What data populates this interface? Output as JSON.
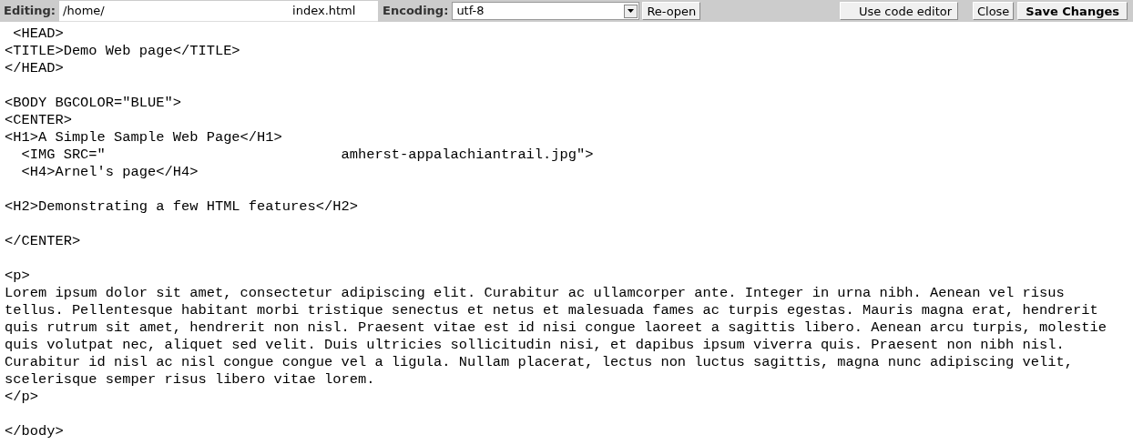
{
  "toolbar": {
    "editing_label": "Editing:",
    "path": "/home/",
    "filename": "index.html",
    "encoding_label": "Encoding:",
    "encoding": "utf-8",
    "reopen": "Re-open",
    "code_editor": "Use code editor",
    "close": "Close",
    "save": "Save Changes"
  },
  "editor": {
    "blocks": [
      {
        "lines": [
          " <HEAD>",
          "<TITLE>Demo Web page</TITLE>",
          "</HEAD>"
        ]
      },
      {
        "lines": [
          "<BODY BGCOLOR=\"BLUE\">",
          "<CENTER>",
          "<H1>A Simple Sample Web Page</H1>",
          "  <IMG SRC=\"                            amherst-appalachiantrail.jpg\">",
          "  <H4>Arnel's page</H4>"
        ]
      },
      {
        "lines": [
          "<H2>Demonstrating a few HTML features</H2>"
        ]
      },
      {
        "lines": [
          "</CENTER>"
        ]
      },
      {
        "lines": [
          "<p>",
          "Lorem ipsum dolor sit amet, consectetur adipiscing elit. Curabitur ac ullamcorper ante. Integer in urna nibh. Aenean vel risus",
          "tellus. Pellentesque habitant morbi tristique senectus et netus et malesuada fames ac turpis egestas. Mauris magna erat, hendrerit",
          "quis rutrum sit amet, hendrerit non nisl. Praesent vitae est id nisi congue laoreet a sagittis libero. Aenean arcu turpis, molestie",
          "quis volutpat nec, aliquet sed velit. Duis ultricies sollicitudin nisi, et dapibus ipsum viverra quis. Praesent non nibh nisl.",
          "Curabitur id nisl ac nisl congue congue vel a ligula. Nullam placerat, lectus non luctus sagittis, magna nunc adipiscing velit,",
          "scelerisque semper risus libero vitae lorem.",
          "</p>"
        ]
      },
      {
        "lines": [
          "</body>"
        ]
      }
    ]
  }
}
